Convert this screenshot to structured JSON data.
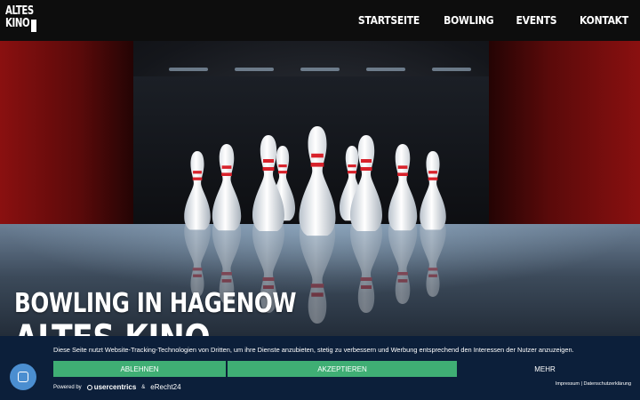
{
  "header": {
    "logo_line1": "ALTES",
    "logo_line2": "KINO",
    "nav": [
      "STARTSEITE",
      "BOWLING",
      "EVENTS",
      "KONTAKT"
    ]
  },
  "hero": {
    "title": "BOWLING IN HAGENOW",
    "subtitle": "ALTES KINO"
  },
  "cookie_banner": {
    "text": "Diese Seite nutzt Website-Tracking-Technologien von Dritten, um ihre Dienste anzubieten, stetig zu verbessern und Werbung entsprechend den Interessen der Nutzer anzuzeigen.",
    "decline_label": "ABLEHNEN",
    "accept_label": "AKZEPTIEREN",
    "more_label": "MEHR",
    "powered_by": "Powered by",
    "powered_brand": "usercentrics",
    "powered_amp": "&",
    "powered_partner": "eRecht24",
    "legal_links": "Impressum | Datenschutzerklärung"
  },
  "colors": {
    "banner_bg": "#0c1f3a",
    "button_green": "#3fae74",
    "badge_blue": "#4b8ed0",
    "header_bg": "#0d0d0d"
  },
  "icons": {
    "privacy_badge": "fingerprint-icon",
    "usercentrics_logo": "usercentrics-logo-icon"
  }
}
